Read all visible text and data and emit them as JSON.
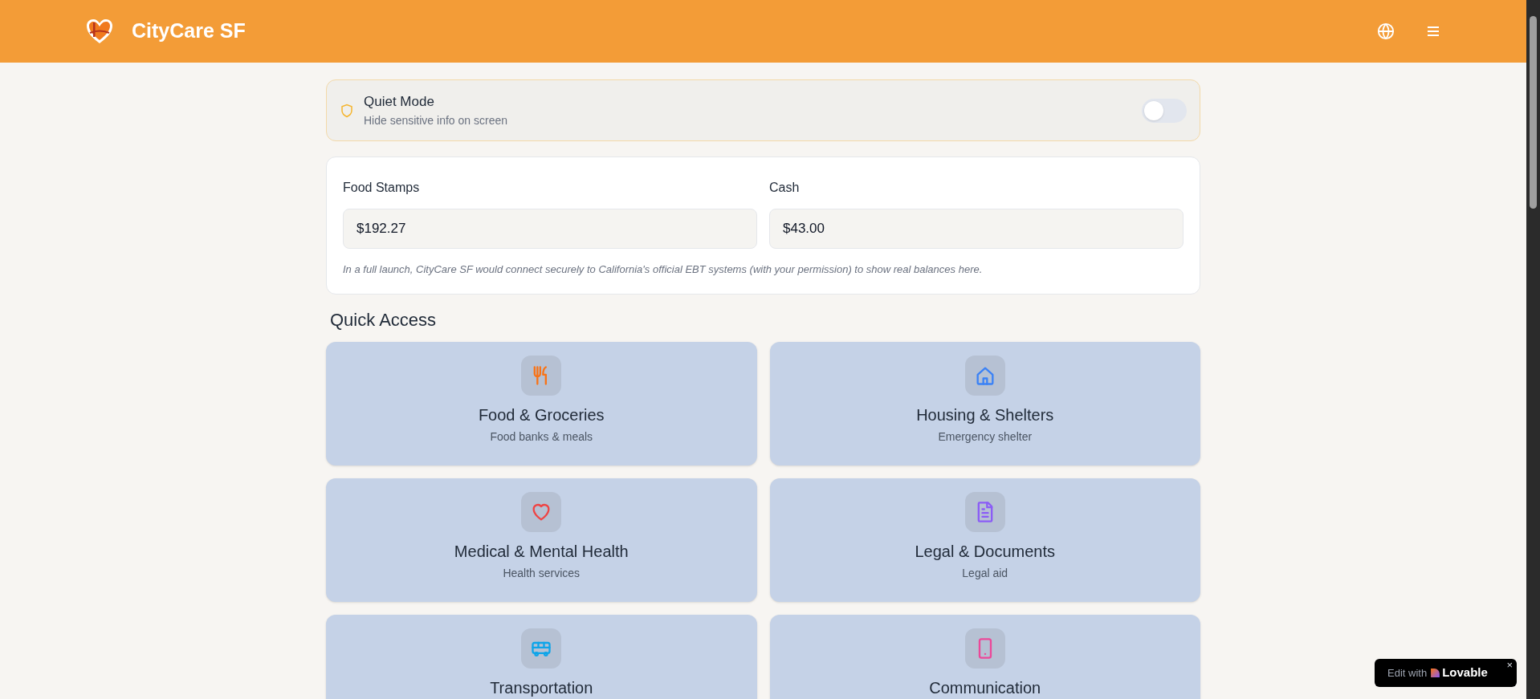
{
  "header": {
    "title": "CityCare SF"
  },
  "quiet_mode": {
    "title": "Quiet Mode",
    "subtitle": "Hide sensitive info on screen",
    "on": false
  },
  "balances": {
    "fields": [
      {
        "label": "Food Stamps",
        "value": "$192.27"
      },
      {
        "label": "Cash",
        "value": "$43.00"
      }
    ],
    "note": "In a full launch, CityCare SF would connect securely to California's official EBT systems (with your permission) to show real balances here."
  },
  "quick_access": {
    "heading": "Quick Access",
    "cards": [
      {
        "kind": "utensils",
        "title": "Food & Groceries",
        "subtitle": "Food banks & meals",
        "color": "#f97316"
      },
      {
        "kind": "house",
        "title": "Housing & Shelters",
        "subtitle": "Emergency shelter",
        "color": "#3b82f6"
      },
      {
        "kind": "heart",
        "title": "Medical & Mental Health",
        "subtitle": "Health services",
        "color": "#ef4444"
      },
      {
        "kind": "document",
        "title": "Legal & Documents",
        "subtitle": "Legal aid",
        "color": "#8b5cf6"
      },
      {
        "kind": "bus",
        "title": "Transportation",
        "color": "#0ea5e9"
      },
      {
        "kind": "phone",
        "title": "Communication",
        "color": "#ec4899"
      }
    ]
  },
  "badge": {
    "prefix": "Edit with",
    "brand": "Lovable",
    "close": "×"
  }
}
